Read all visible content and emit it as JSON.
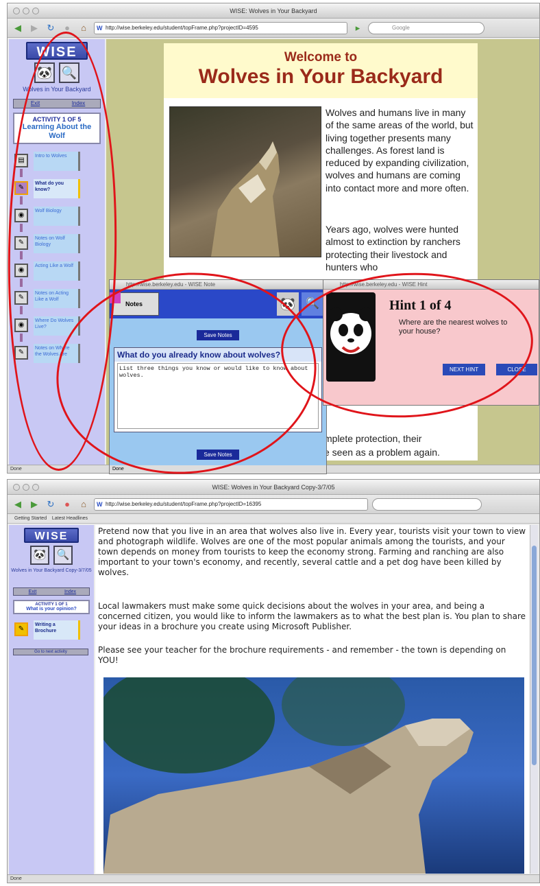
{
  "window1": {
    "title": "WISE: Wolves in Your Backyard",
    "url": "http://wise.berkeley.edu/student/topFrame.php?projectID=4595",
    "search_placeholder": "Google",
    "status": "Done",
    "sidebar": {
      "logo": "WISE",
      "project_title": "Wolves in Your Backyard",
      "exit_label": "Exit",
      "index_label": "Index",
      "activity_label": "ACTIVITY 1 OF 5",
      "activity_name": "Learning About the Wolf",
      "steps": [
        {
          "label": "Intro to Wolves"
        },
        {
          "label": "What do you know?"
        },
        {
          "label": "Wolf Biology"
        },
        {
          "label": "Notes on Wolf Biology"
        },
        {
          "label": "Acting Like a Wolf"
        },
        {
          "label": "Notes on Acting Like a Wolf"
        },
        {
          "label": "Where Do Wolves Live?"
        },
        {
          "label": "Notes on Where the Wolves Are"
        }
      ]
    },
    "page": {
      "welcome": "Welcome to",
      "heading": "Wolves in Your Backyard",
      "para1": "Wolves and humans live in many of the same areas of the world, but living together presents many challenges. As forest land is reduced by expanding civilization, wolves and humans are coming into contact more and more often.",
      "para2": "Years ago, wolves were hunted almost to extinction by ranchers protecting their livestock and hunters who",
      "fragment1": "mplete protection, their",
      "fragment2": "e seen as a problem again."
    },
    "notes_popup": {
      "title_url": "http://wise.berkeley.edu",
      "title_suffix": "WISE Note",
      "tab_label": "Notes",
      "save_label": "Save Notes",
      "question": "What do you already know about wolves?",
      "answer": "List three things you know or would like to know about wolves.",
      "status": "Done"
    },
    "hint_popup": {
      "title_url": "http://wise.berkeley.edu",
      "title_suffix": "WISE Hint",
      "heading": "Hint 1 of 4",
      "text": "Where are the nearest wolves to your house?",
      "next_label": "NEXT HINT",
      "close_label": "CLOSE"
    }
  },
  "window2": {
    "title": "WISE: Wolves in Your Backyard Copy-3/7/05",
    "url": "http://wise.berkeley.edu/student/topFrame.php?projectID=16395",
    "bookmarks": [
      "Getting Started",
      "Latest Headlines"
    ],
    "status": "Done",
    "sidebar": {
      "logo": "WISE",
      "project_title": "Wolves in Your Backyard Copy-3/7/05",
      "exit_label": "Exit",
      "index_label": "Index",
      "activity_label": "ACTIVITY 1 OF 1",
      "activity_name": "What is your opinion?",
      "step_label": "Writing a Brochure",
      "button_label": "Go to next activity"
    },
    "page": {
      "para1": "Pretend now that you live in an area that wolves also live in.  Every year, tourists visit your town to view and photograph wildlife.  Wolves are one of the most popular animals among the tourists, and your town depends on money from tourists to keep the economy strong.  Farming and ranching are also important to your town's economy, and recently, several cattle and a pet dog have been killed by wolves.",
      "para2": "Local lawmakers must make some quick decisions about the wolves in your area, and being a concerned citizen, you would like to inform the lawmakers as to what the best plan is.  You plan to share your ideas in a brochure you create using Microsoft Publisher.",
      "para3": "Please see your teacher for the brochure requirements - and remember - the town is depending on YOU!"
    }
  },
  "colors": {
    "annotation_red": "#e0141a",
    "sidebar_lavender": "#c8c8f4",
    "heading_maroon": "#9a2a1a",
    "hint_pink": "#f8c8cc"
  }
}
